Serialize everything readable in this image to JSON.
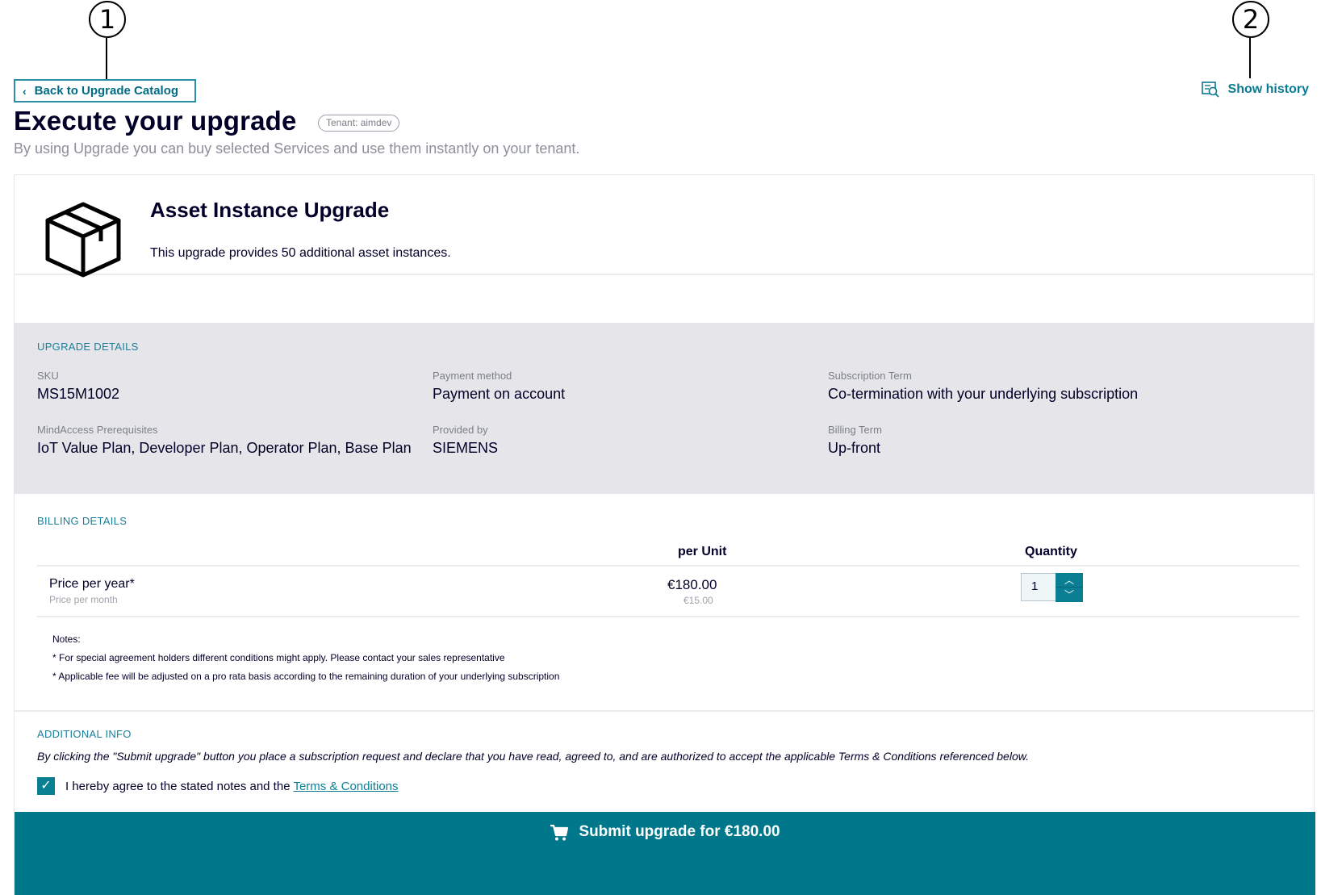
{
  "callouts": [
    "1",
    "2"
  ],
  "nav": {
    "back_label": "Back to Upgrade Catalog",
    "show_history_label": "Show history"
  },
  "header": {
    "title": "Execute your upgrade",
    "tenant_badge": "Tenant: aimdev",
    "subtitle": "By using Upgrade you can buy selected Services and use them instantly on your tenant."
  },
  "product": {
    "icon": "box-icon",
    "title": "Asset Instance Upgrade",
    "description": "This upgrade provides 50 additional asset instances."
  },
  "upgrade_details": {
    "section_label": "UPGRADE DETAILS",
    "fields": [
      {
        "label": "SKU",
        "value": "MS15M1002"
      },
      {
        "label": "Payment method",
        "value": "Payment on account"
      },
      {
        "label": "Subscription Term",
        "value": "Co-termination with your underlying subscription"
      },
      {
        "label": "MindAccess Prerequisites",
        "value": "IoT Value Plan, Developer Plan, Operator Plan, Base Plan"
      },
      {
        "label": "Provided by",
        "value": "SIEMENS"
      },
      {
        "label": "Billing Term",
        "value": "Up-front"
      }
    ]
  },
  "billing_details": {
    "section_label": "BILLING DETAILS",
    "col_per_unit": "per Unit",
    "col_quantity": "Quantity",
    "price_label": "Price per year*",
    "price_sublabel": "Price per month",
    "price_value": "€180.00",
    "price_month_value": "€15.00",
    "quantity": "1",
    "notes_title": "Notes:",
    "notes": [
      "* For special agreement holders different conditions might apply. Please contact your sales representative",
      "* Applicable fee will be adjusted on a pro rata basis according to the remaining duration of your underlying subscription"
    ]
  },
  "additional_info": {
    "section_label": "ADDITIONAL INFO",
    "text": "By clicking the \"Submit upgrade\" button you place a subscription request and declare that you have read, agreed to, and are authorized to accept the applicable Terms & Conditions referenced below.",
    "agree_text": "I hereby agree to the stated notes and the",
    "terms_link": "Terms & Conditions",
    "agree_checked": true
  },
  "submit": {
    "label": "Submit upgrade for €180.00",
    "icon": "cart-icon"
  },
  "colors": {
    "accent": "#00778a",
    "link": "#0a7f93",
    "details_bg": "#e6e6ea",
    "text": "#000028"
  }
}
